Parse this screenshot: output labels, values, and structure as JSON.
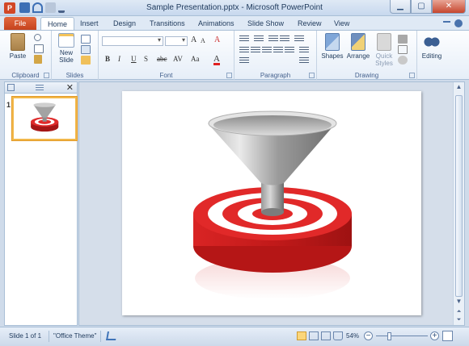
{
  "window": {
    "title": "Sample Presentation.pptx - Microsoft PowerPoint",
    "app_letter": "P"
  },
  "tabs": {
    "file": "File",
    "items": [
      "Home",
      "Insert",
      "Design",
      "Transitions",
      "Animations",
      "Slide Show",
      "Review",
      "View"
    ],
    "active": "Home"
  },
  "ribbon": {
    "clipboard": {
      "label": "Clipboard",
      "paste": "Paste"
    },
    "slides": {
      "label": "Slides",
      "new_slide_1": "New",
      "new_slide_2": "Slide"
    },
    "font": {
      "label": "Font",
      "bold": "B",
      "italic": "I",
      "underline": "U",
      "strike": "S",
      "shadow": "abc",
      "spacing": "AV",
      "case": "Aa",
      "grow": "A",
      "shrink": "A",
      "color": "A"
    },
    "paragraph": {
      "label": "Paragraph"
    },
    "drawing": {
      "label": "Drawing",
      "shapes": "Shapes",
      "arrange": "Arrange",
      "quick_styles_1": "Quick",
      "quick_styles_2": "Styles"
    },
    "editing": {
      "label": "Editing"
    }
  },
  "slides_pane": {
    "thumb_number": "1"
  },
  "statusbar": {
    "slide_info": "Slide 1 of 1",
    "theme": "\"Office Theme\"",
    "zoom": "54%",
    "zoom_level": 0.54,
    "minus": "−",
    "plus": "+"
  },
  "colors": {
    "file_tab": "#d24726",
    "accent": "#1e395b",
    "target_red": "#e02b2b"
  }
}
